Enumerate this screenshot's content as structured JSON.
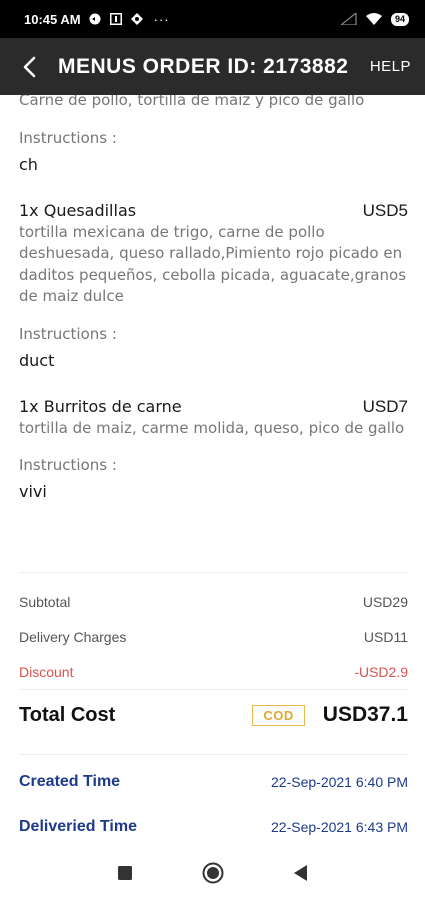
{
  "status_bar": {
    "time": "10:45 AM",
    "dots": "···",
    "battery": "94",
    "icons": [
      "chat-icon",
      "notification-box-icon",
      "location-icon",
      "signal-icon",
      "wifi-icon",
      "battery-icon"
    ]
  },
  "header": {
    "title": "MENUS ORDER ID: 2173882",
    "help_label": "HELP",
    "back_icon": "back-arrow-icon"
  },
  "items": [
    {
      "name": "",
      "price": "",
      "description": "Carne de pollo, tortilla de maiz y pico de gallo",
      "instructions_label": "Instructions :",
      "instructions": "ch"
    },
    {
      "name": "1x Quesadillas",
      "price": "USD5",
      "description": "tortilla mexicana de trigo, carne de pollo deshuesada, queso rallado,Pimiento rojo picado en daditos pequeños, cebolla picada, aguacate,granos de maiz dulce",
      "instructions_label": "Instructions :",
      "instructions": "duct"
    },
    {
      "name": "1x Burritos de carne",
      "price": "USD7",
      "description": "tortilla de maiz, carme molida, queso, pico de gallo",
      "instructions_label": "Instructions :",
      "instructions": "vivi"
    }
  ],
  "summary": {
    "subtotal_label": "Subtotal",
    "subtotal": "USD29",
    "delivery_label": "Delivery Charges",
    "delivery": "USD11",
    "discount_label": "Discount",
    "discount": "-USD2.9",
    "total_label": "Total Cost",
    "payment_badge": "COD",
    "total": "USD37.1"
  },
  "times": {
    "created_label": "Created Time",
    "created": "22-Sep-2021 6:40 PM",
    "delivered_label": "Deliveried Time",
    "delivered": "22-Sep-2021 6:43 PM"
  },
  "colors": {
    "app_bar": "#2b2b2b",
    "discount": "#d9534f",
    "badge": "#e0a82e",
    "time_text": "#1e3a8a"
  },
  "nav_bar": {
    "icons": [
      "recents-square-icon",
      "home-circle-icon",
      "back-triangle-icon"
    ]
  }
}
